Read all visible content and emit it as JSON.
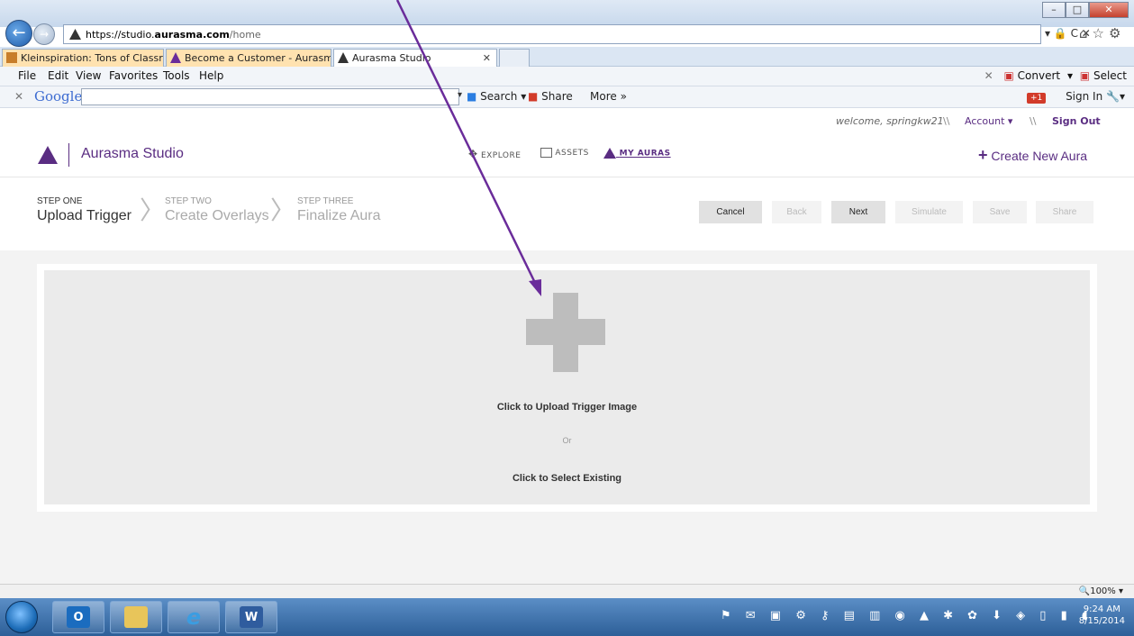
{
  "browser": {
    "url_host": "https://studio.",
    "url_domain": "aurasma.com",
    "url_path": "/home",
    "url_controls": "▾ 🔒 C ✕",
    "window_buttons": [
      "–",
      "□",
      "✕"
    ],
    "tabs": [
      {
        "label": "Kleinspiration: Tons of Classro..."
      },
      {
        "label": "Become a Customer - Aurasma"
      },
      {
        "label": "Aurasma Studio"
      }
    ],
    "menu": [
      "File",
      "Edit",
      "View",
      "Favorites",
      "Tools",
      "Help"
    ],
    "menu_right": {
      "close": "✕",
      "convert": "Convert",
      "select": "Select"
    },
    "google_toolbar": {
      "close": "✕",
      "logo": "Google",
      "search_value": "",
      "search_label": "Search",
      "share_label": "Share",
      "more_label": "More »",
      "sign_in": "Sign In",
      "gplus": "+1"
    },
    "zoom": "100%"
  },
  "site": {
    "welcome": "welcome, springkw21",
    "separator": "\\\\",
    "account": "Account ▾",
    "sign_out": "Sign Out",
    "logo_text": "Aurasma Studio",
    "nav": [
      {
        "label": "EXPLORE",
        "icon": "explore-icon"
      },
      {
        "label": "ASSETS",
        "icon": "assets-icon"
      },
      {
        "label": "MY AURAS",
        "icon": "aurasma-logo-icon"
      }
    ],
    "create_new": "Create New Aura",
    "steps": [
      {
        "label": "STEP ONE",
        "name": "Upload Trigger"
      },
      {
        "label": "STEP TWO",
        "name": "Create Overlays"
      },
      {
        "label": "STEP THREE",
        "name": "Finalize Aura"
      }
    ],
    "actions": [
      {
        "label": "Cancel",
        "enabled": true
      },
      {
        "label": "Back",
        "enabled": false
      },
      {
        "label": "Next",
        "enabled": true
      },
      {
        "label": "Simulate",
        "enabled": false
      },
      {
        "label": "Save",
        "enabled": false
      },
      {
        "label": "Share",
        "enabled": false
      }
    ],
    "upload": {
      "primary": "Click to Upload Trigger Image",
      "or": "Or",
      "secondary": "Click to Select Existing"
    },
    "brand_color": "#5a2d82",
    "annotation_color": "#6a2c9a"
  },
  "taskbar": {
    "apps": [
      {
        "name": "outlook-icon",
        "glyph": "O"
      },
      {
        "name": "explorer-icon",
        "glyph": ""
      },
      {
        "name": "ie-icon",
        "glyph": "e"
      },
      {
        "name": "word-icon",
        "glyph": "W"
      }
    ],
    "time": "9:24 AM",
    "date": "8/15/2014"
  }
}
